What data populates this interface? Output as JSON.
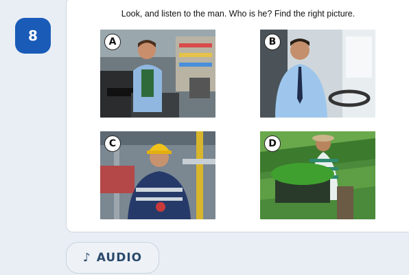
{
  "question": {
    "number": "8",
    "prompt": "Look, and listen to the man. Who is he? Find the right picture."
  },
  "options": [
    {
      "letter": "A",
      "icon": "photo-cashier-supermarket"
    },
    {
      "letter": "B",
      "icon": "photo-bus-driver"
    },
    {
      "letter": "C",
      "icon": "photo-factory-worker-hardhat"
    },
    {
      "letter": "D",
      "icon": "photo-farmer-vegetables"
    }
  ],
  "audio": {
    "icon": "♪",
    "label": "AUDIO"
  },
  "colors": {
    "accent": "#1a5bb8",
    "background": "#e9eef4",
    "card": "#ffffff"
  }
}
